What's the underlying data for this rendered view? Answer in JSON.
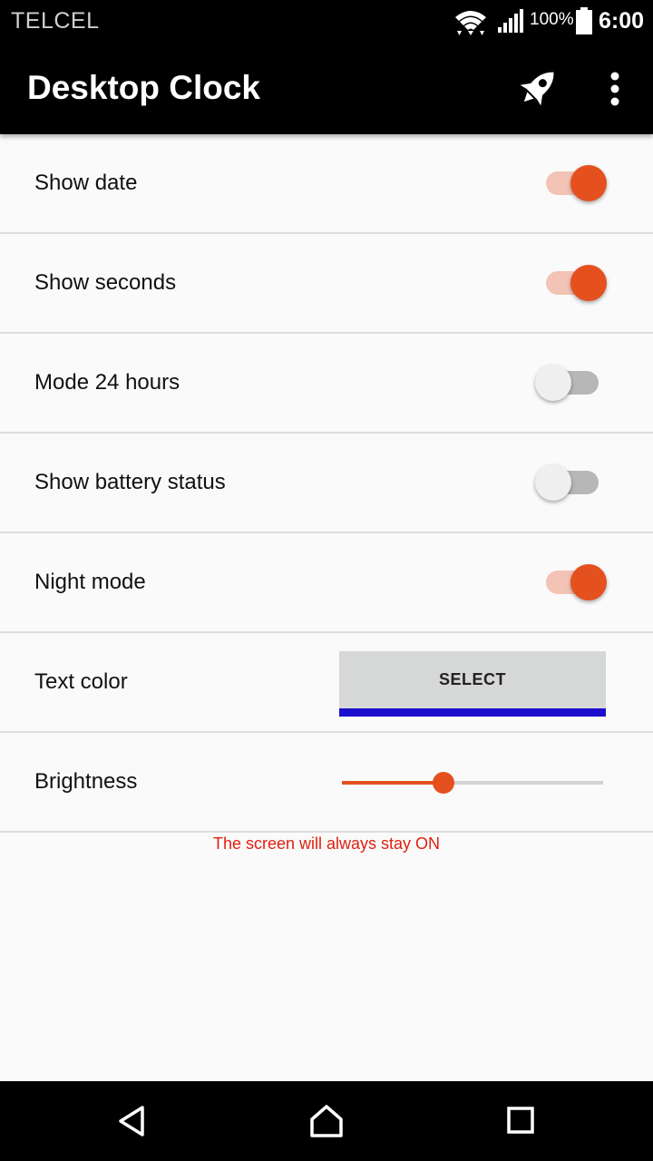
{
  "status_bar": {
    "carrier": "TELCEL",
    "battery_percent": "100%",
    "time": "6:00",
    "icons": [
      "wifi-icon",
      "signal-icon",
      "battery-icon"
    ]
  },
  "toolbar": {
    "title": "Desktop Clock",
    "actions": [
      "rocket-icon",
      "overflow-menu-icon"
    ]
  },
  "settings": {
    "show_date": {
      "label": "Show date",
      "checked": true
    },
    "show_seconds": {
      "label": "Show seconds",
      "checked": true
    },
    "mode_24": {
      "label": "Mode 24 hours",
      "checked": false
    },
    "battery_status": {
      "label": "Show battery status",
      "checked": false
    },
    "night_mode": {
      "label": "Night mode",
      "checked": true
    },
    "text_color": {
      "label": "Text color",
      "button_label": "SELECT"
    },
    "brightness": {
      "label": "Brightness",
      "value_percent": 39
    }
  },
  "notice": "The screen will always stay ON",
  "navigation": [
    "back-icon",
    "home-icon",
    "recents-icon"
  ],
  "colors": {
    "accent": "#e5501f",
    "accent_track": "#f3c3b5",
    "select_underline": "#1a0fcc",
    "notice": "#e02010"
  }
}
